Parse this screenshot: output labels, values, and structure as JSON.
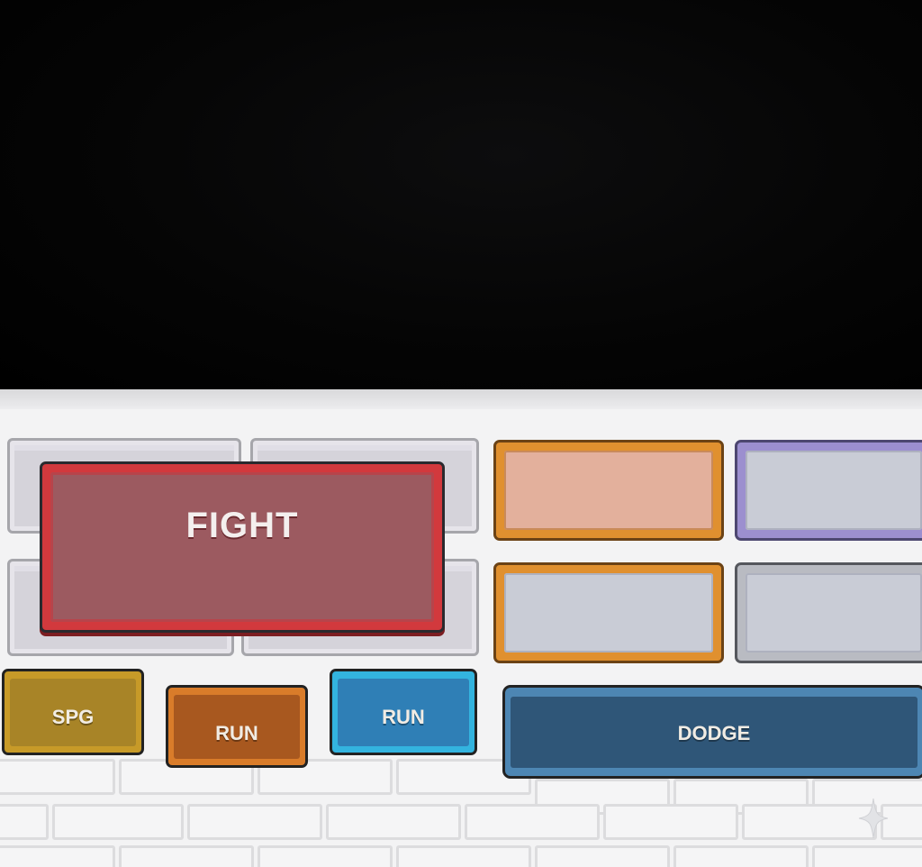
{
  "hud": {
    "fight_label": "FIGHT",
    "buttons": {
      "spg": "SPG",
      "run_orange": "RUN",
      "run_blue": "RUN",
      "dodge": "DODGE"
    }
  },
  "colors": {
    "fight": "#d2393d",
    "spg": "#c79a28",
    "run_orange": "#c06a22",
    "run_blue": "#2f7fb6",
    "dodge": "#2f5678",
    "slot_orange": "#e0902f",
    "slot_purple": "#9c8fcf"
  }
}
